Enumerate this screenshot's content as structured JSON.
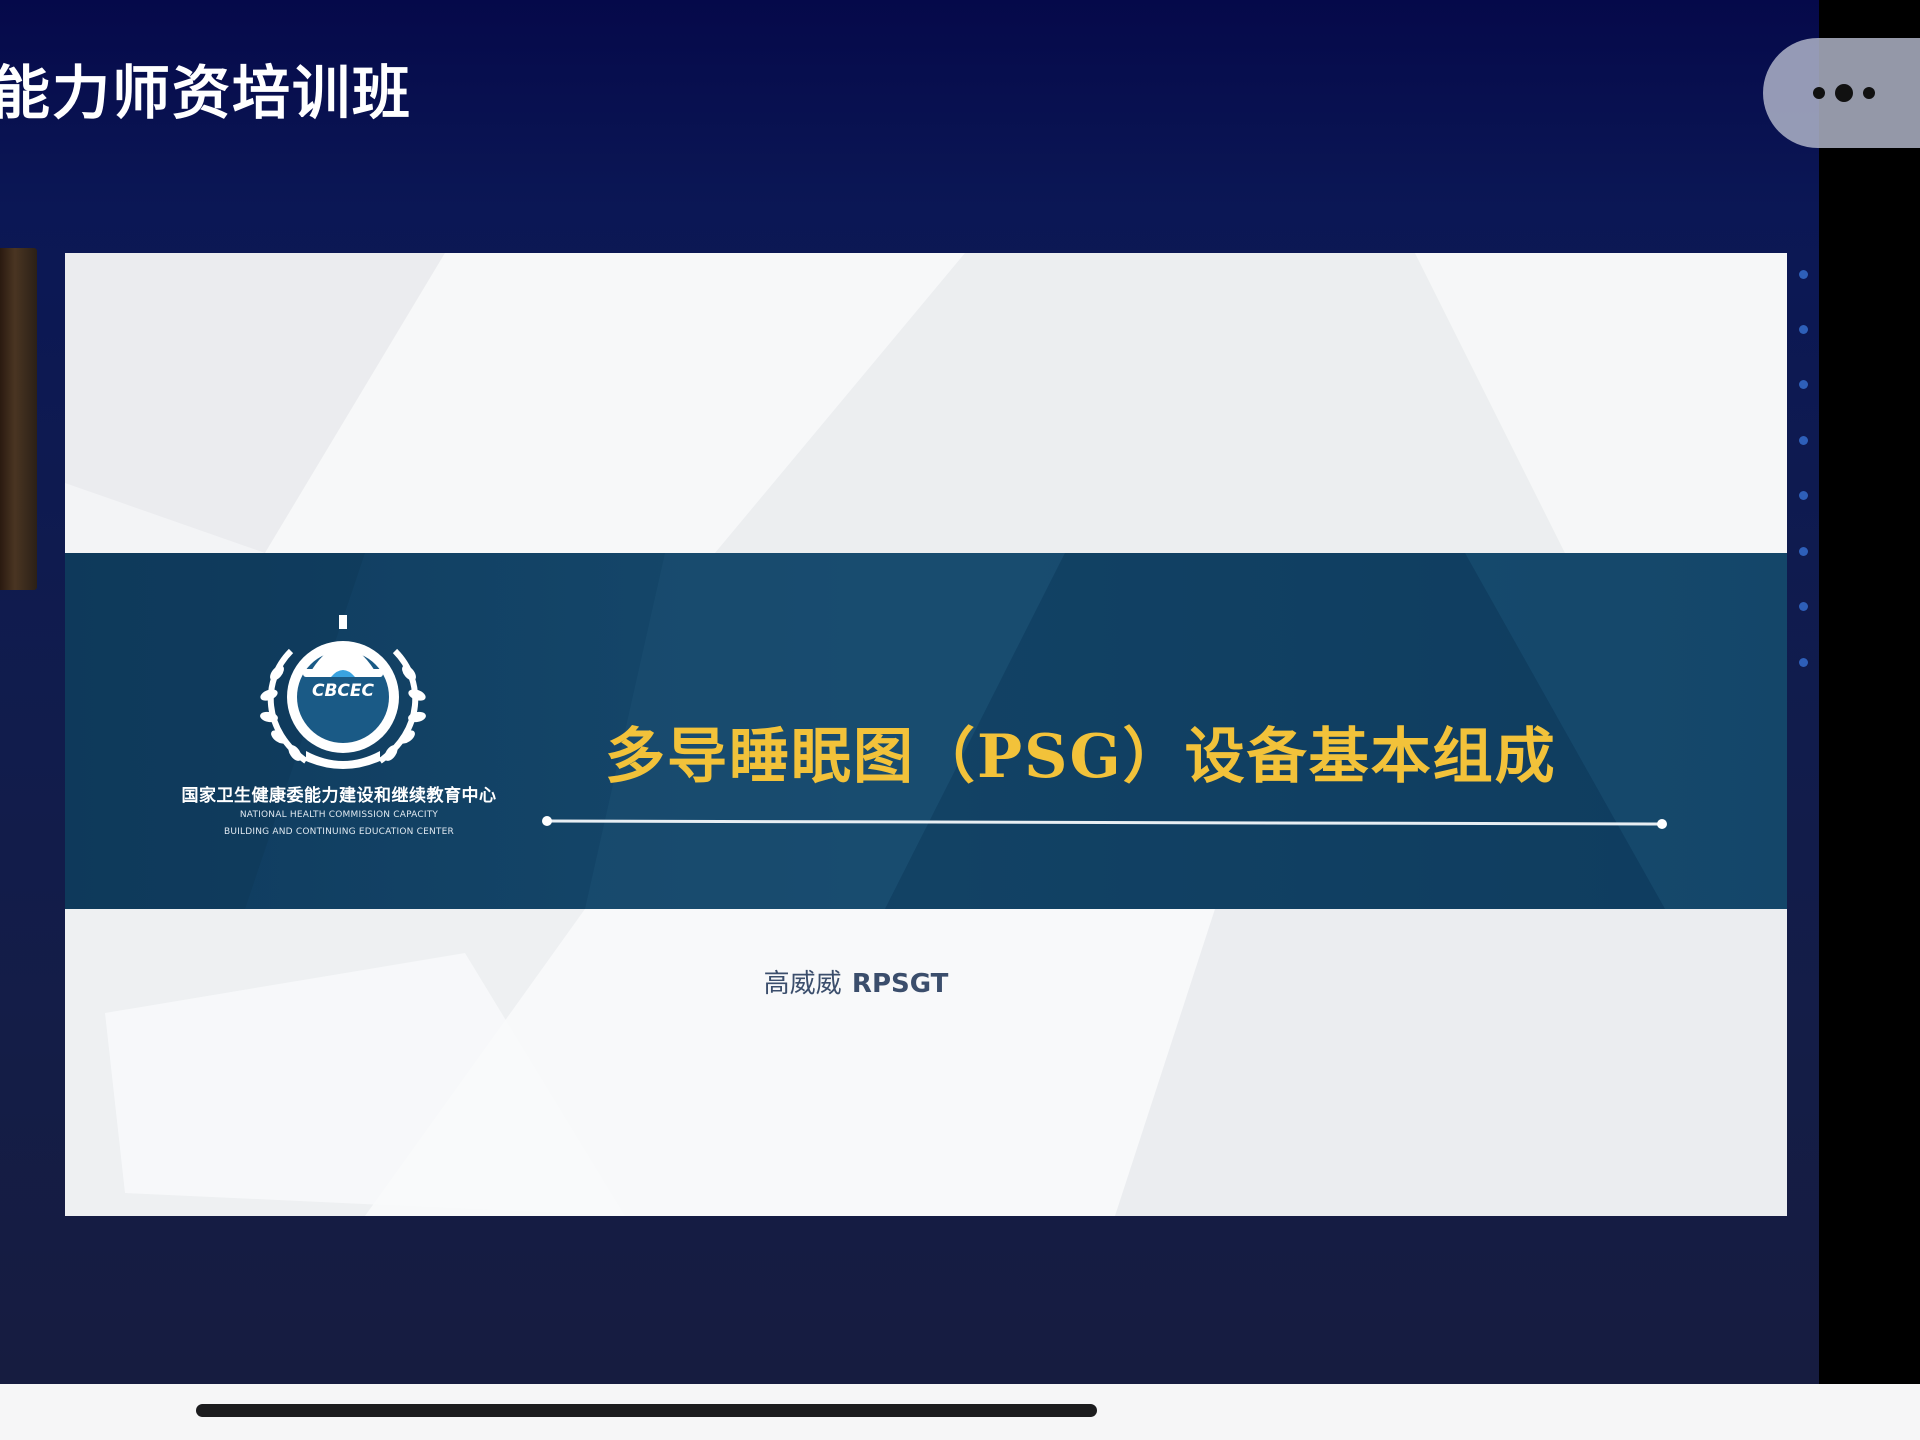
{
  "header": {
    "title": "能力师资培训班"
  },
  "controls": {
    "more_icon": "ellipsis-icon"
  },
  "slide": {
    "logo": {
      "emblem_text": "CBCEC",
      "org_name_cn": "国家卫生健康委能力建设和继续教育中心",
      "org_name_en_line1": "NATIONAL HEALTH COMMISSION CAPACITY",
      "org_name_en_line2": "BUILDING AND CONTINUING EDUCATION CENTER"
    },
    "title": "多导睡眠图（PSG）设备基本组成",
    "presenter_name": "高威威",
    "presenter_credential": "RPSGT"
  },
  "colors": {
    "background_top": "#05094a",
    "band": "#164a6d",
    "title_gold": "#f2c23a",
    "accent_dots": "#2e5fb8"
  }
}
